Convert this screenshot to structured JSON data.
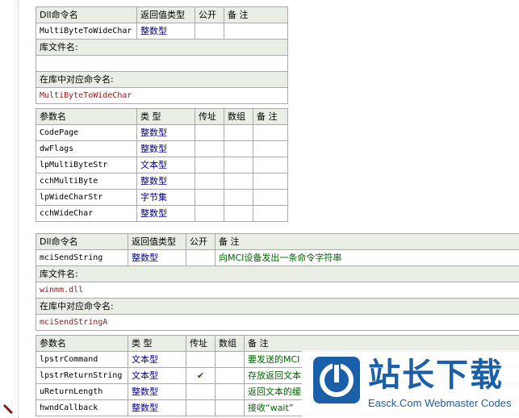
{
  "table1": {
    "hdr": [
      "Dll命令名",
      "返回值类型",
      "公开",
      "备 注"
    ],
    "name": "MultiByteToWideChar",
    "ret": "整数型",
    "lib_label": "库文件名:",
    "lib_value": "",
    "alias_label": "在库中对应命令名:",
    "alias_value": "MultiByteToWideChar",
    "param_hdr": [
      "参数名",
      "类 型",
      "传址",
      "数组",
      "备 注"
    ],
    "params": [
      {
        "name": "CodePage",
        "type": "整数型"
      },
      {
        "name": "dwFlags",
        "type": "整数型"
      },
      {
        "name": "lpMultiByteStr",
        "type": "文本型"
      },
      {
        "name": "cchMultiByte",
        "type": "整数型"
      },
      {
        "name": "lpWideCharStr",
        "type": "字节集"
      },
      {
        "name": "cchWideChar",
        "type": "整数型"
      }
    ]
  },
  "table2": {
    "hdr": [
      "Dll命令名",
      "返回值类型",
      "公开",
      "备 注"
    ],
    "name": "mciSendString",
    "ret": "整数型",
    "note": "向MCI设备发出一条命令字符串",
    "lib_label": "库文件名:",
    "lib_value": "winmm.dll",
    "alias_label": "在库中对应命令名:",
    "alias_value": "mciSendStringA",
    "param_hdr": [
      "参数名",
      "类 型",
      "传址",
      "数组",
      "备 注"
    ],
    "params": [
      {
        "name": "lpstrCommand",
        "type": "文本型",
        "note": "要发送的MCI"
      },
      {
        "name": "lpstrReturnString",
        "type": "文本型",
        "note": "存放返回文本"
      },
      {
        "name": "uReturnLength",
        "type": "整数型",
        "note": "返回文本的缓"
      },
      {
        "name": "hwndCallback",
        "type": "整数型",
        "note": "接收“wait”"
      }
    ],
    "check_mark": "✔"
  },
  "watermark": {
    "title": "站长下载",
    "subtitle": "Easck.Com Webmaster Codes"
  },
  "colors": {
    "header_bg": "#e8eee4",
    "border": "#a9a9a9",
    "name_red": "#8b1a1a",
    "type_blue": "#00008b",
    "note_green": "#006400",
    "brand_blue": "#1a5fa8"
  }
}
